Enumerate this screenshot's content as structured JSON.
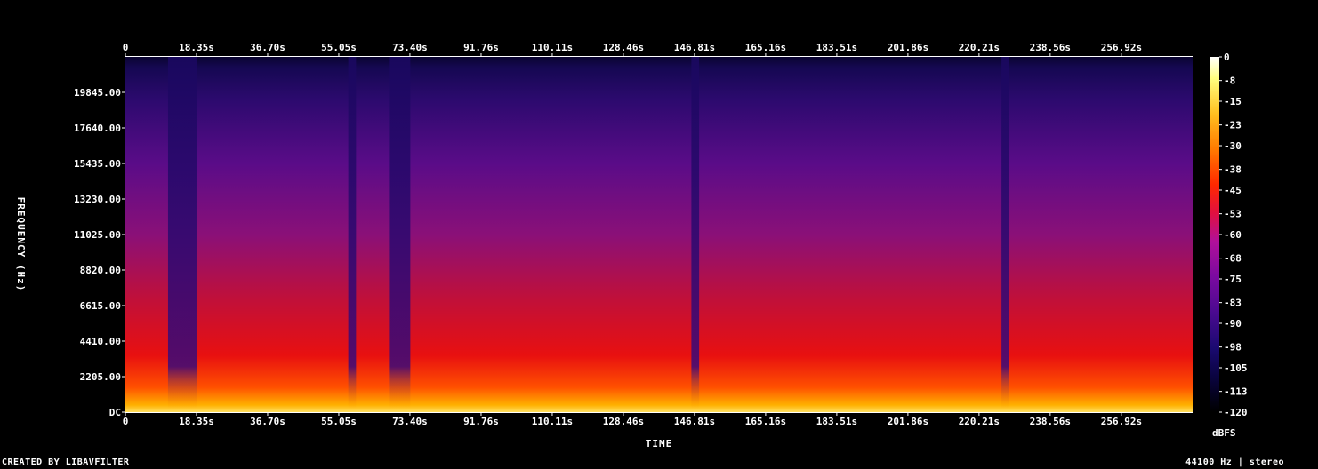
{
  "chart_data": {
    "type": "heatmap",
    "title": "",
    "xlabel": "TIME",
    "ylabel": "FREQUENCY (Hz)",
    "x_ticks": [
      "0",
      "18.35s",
      "36.70s",
      "55.05s",
      "73.40s",
      "91.76s",
      "110.11s",
      "128.46s",
      "146.81s",
      "165.16s",
      "183.51s",
      "201.86s",
      "220.21s",
      "238.56s",
      "256.92s"
    ],
    "x_tick_values": [
      0,
      18.35,
      36.7,
      55.05,
      73.4,
      91.76,
      110.11,
      128.46,
      146.81,
      165.16,
      183.51,
      201.86,
      220.21,
      238.56,
      256.92
    ],
    "xlim": [
      0,
      275.3
    ],
    "y_ticks": [
      "DC",
      "2205.00",
      "4410.00",
      "6615.00",
      "8820.00",
      "11025.00",
      "13230.00",
      "15435.00",
      "17640.00",
      "19845.00"
    ],
    "y_tick_values": [
      0,
      2205,
      4410,
      6615,
      8820,
      11025,
      13230,
      15435,
      17640,
      19845
    ],
    "ylim": [
      0,
      22050
    ],
    "colorbar": {
      "label": "dBFS",
      "ticks": [
        "0",
        "-8",
        "-15",
        "-23",
        "-30",
        "-38",
        "-45",
        "-53",
        "-60",
        "-68",
        "-75",
        "-83",
        "-90",
        "-98",
        "-105",
        "-113",
        "-120"
      ],
      "tick_values": [
        0,
        -8,
        -15,
        -23,
        -30,
        -38,
        -45,
        -53,
        -60,
        -68,
        -75,
        -83,
        -90,
        -98,
        -105,
        -113,
        -120
      ],
      "range": [
        -120,
        0
      ],
      "colors": [
        "#000000",
        "#0a0440",
        "#1a0a70",
        "#4a0a90",
        "#7a0aa0",
        "#b0109a",
        "#e01040",
        "#ff2800",
        "#ff7a00",
        "#ffc020",
        "#ffff80",
        "#ffffff"
      ]
    },
    "quiet_segments_s": [
      [
        11,
        18.5
      ],
      [
        57.5,
        59.5
      ],
      [
        68,
        73.5
      ],
      [
        146,
        148
      ],
      [
        226,
        228
      ]
    ]
  },
  "footer": {
    "left": "CREATED BY LIBAVFILTER",
    "right": "44100 Hz | stereo"
  }
}
